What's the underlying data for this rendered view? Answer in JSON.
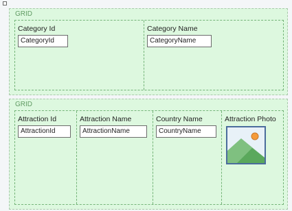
{
  "grid_top": {
    "label": "GRID",
    "columns": [
      {
        "title": "Category Id",
        "field": "CategoryId"
      },
      {
        "title": "Category Name",
        "field": "CategoryName"
      }
    ]
  },
  "grid_bottom": {
    "label": "GRID",
    "columns": [
      {
        "title": "Attraction Id",
        "field": "AttractionId"
      },
      {
        "title": "Attraction Name",
        "field": "AttractionName"
      },
      {
        "title": "Country Name",
        "field": "CountryName"
      },
      {
        "title": "Attraction Photo",
        "image_icon": "image-placeholder-icon"
      }
    ]
  },
  "colors": {
    "panel_background": "#ddf8df",
    "grid_border": "#74b478",
    "label": "#5f9a62"
  }
}
